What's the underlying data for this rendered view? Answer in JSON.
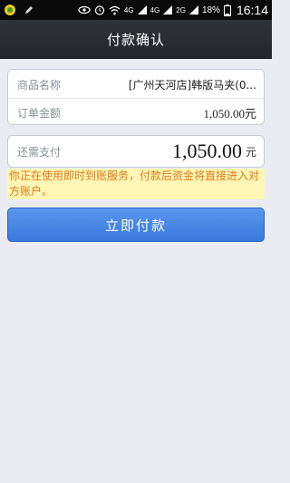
{
  "status_bar": {
    "network_4g_a": "4G",
    "network_4g_b": "4G",
    "network_2g": "2G",
    "battery": "18%",
    "time": "16:14"
  },
  "header": {
    "title": "付款确认"
  },
  "order": {
    "product_label": "商品名称",
    "product_value": "[广州天河店]韩版马夹(0...",
    "amount_label": "订单金额",
    "amount_value": "1,050.00元"
  },
  "payment": {
    "label": "还需支付",
    "amount": "1,050.00",
    "unit": "元"
  },
  "notice": {
    "text": "你正在使用即时到账服务，付款后资金将直接进入对方账户。"
  },
  "actions": {
    "pay_now_label": "立即付款"
  },
  "colors": {
    "nav_bg": "#2b2f33",
    "page_bg": "#eaecf1",
    "notice_bg": "#fdf6b4",
    "notice_text": "#e07a1f",
    "button": "#4a88e6"
  }
}
